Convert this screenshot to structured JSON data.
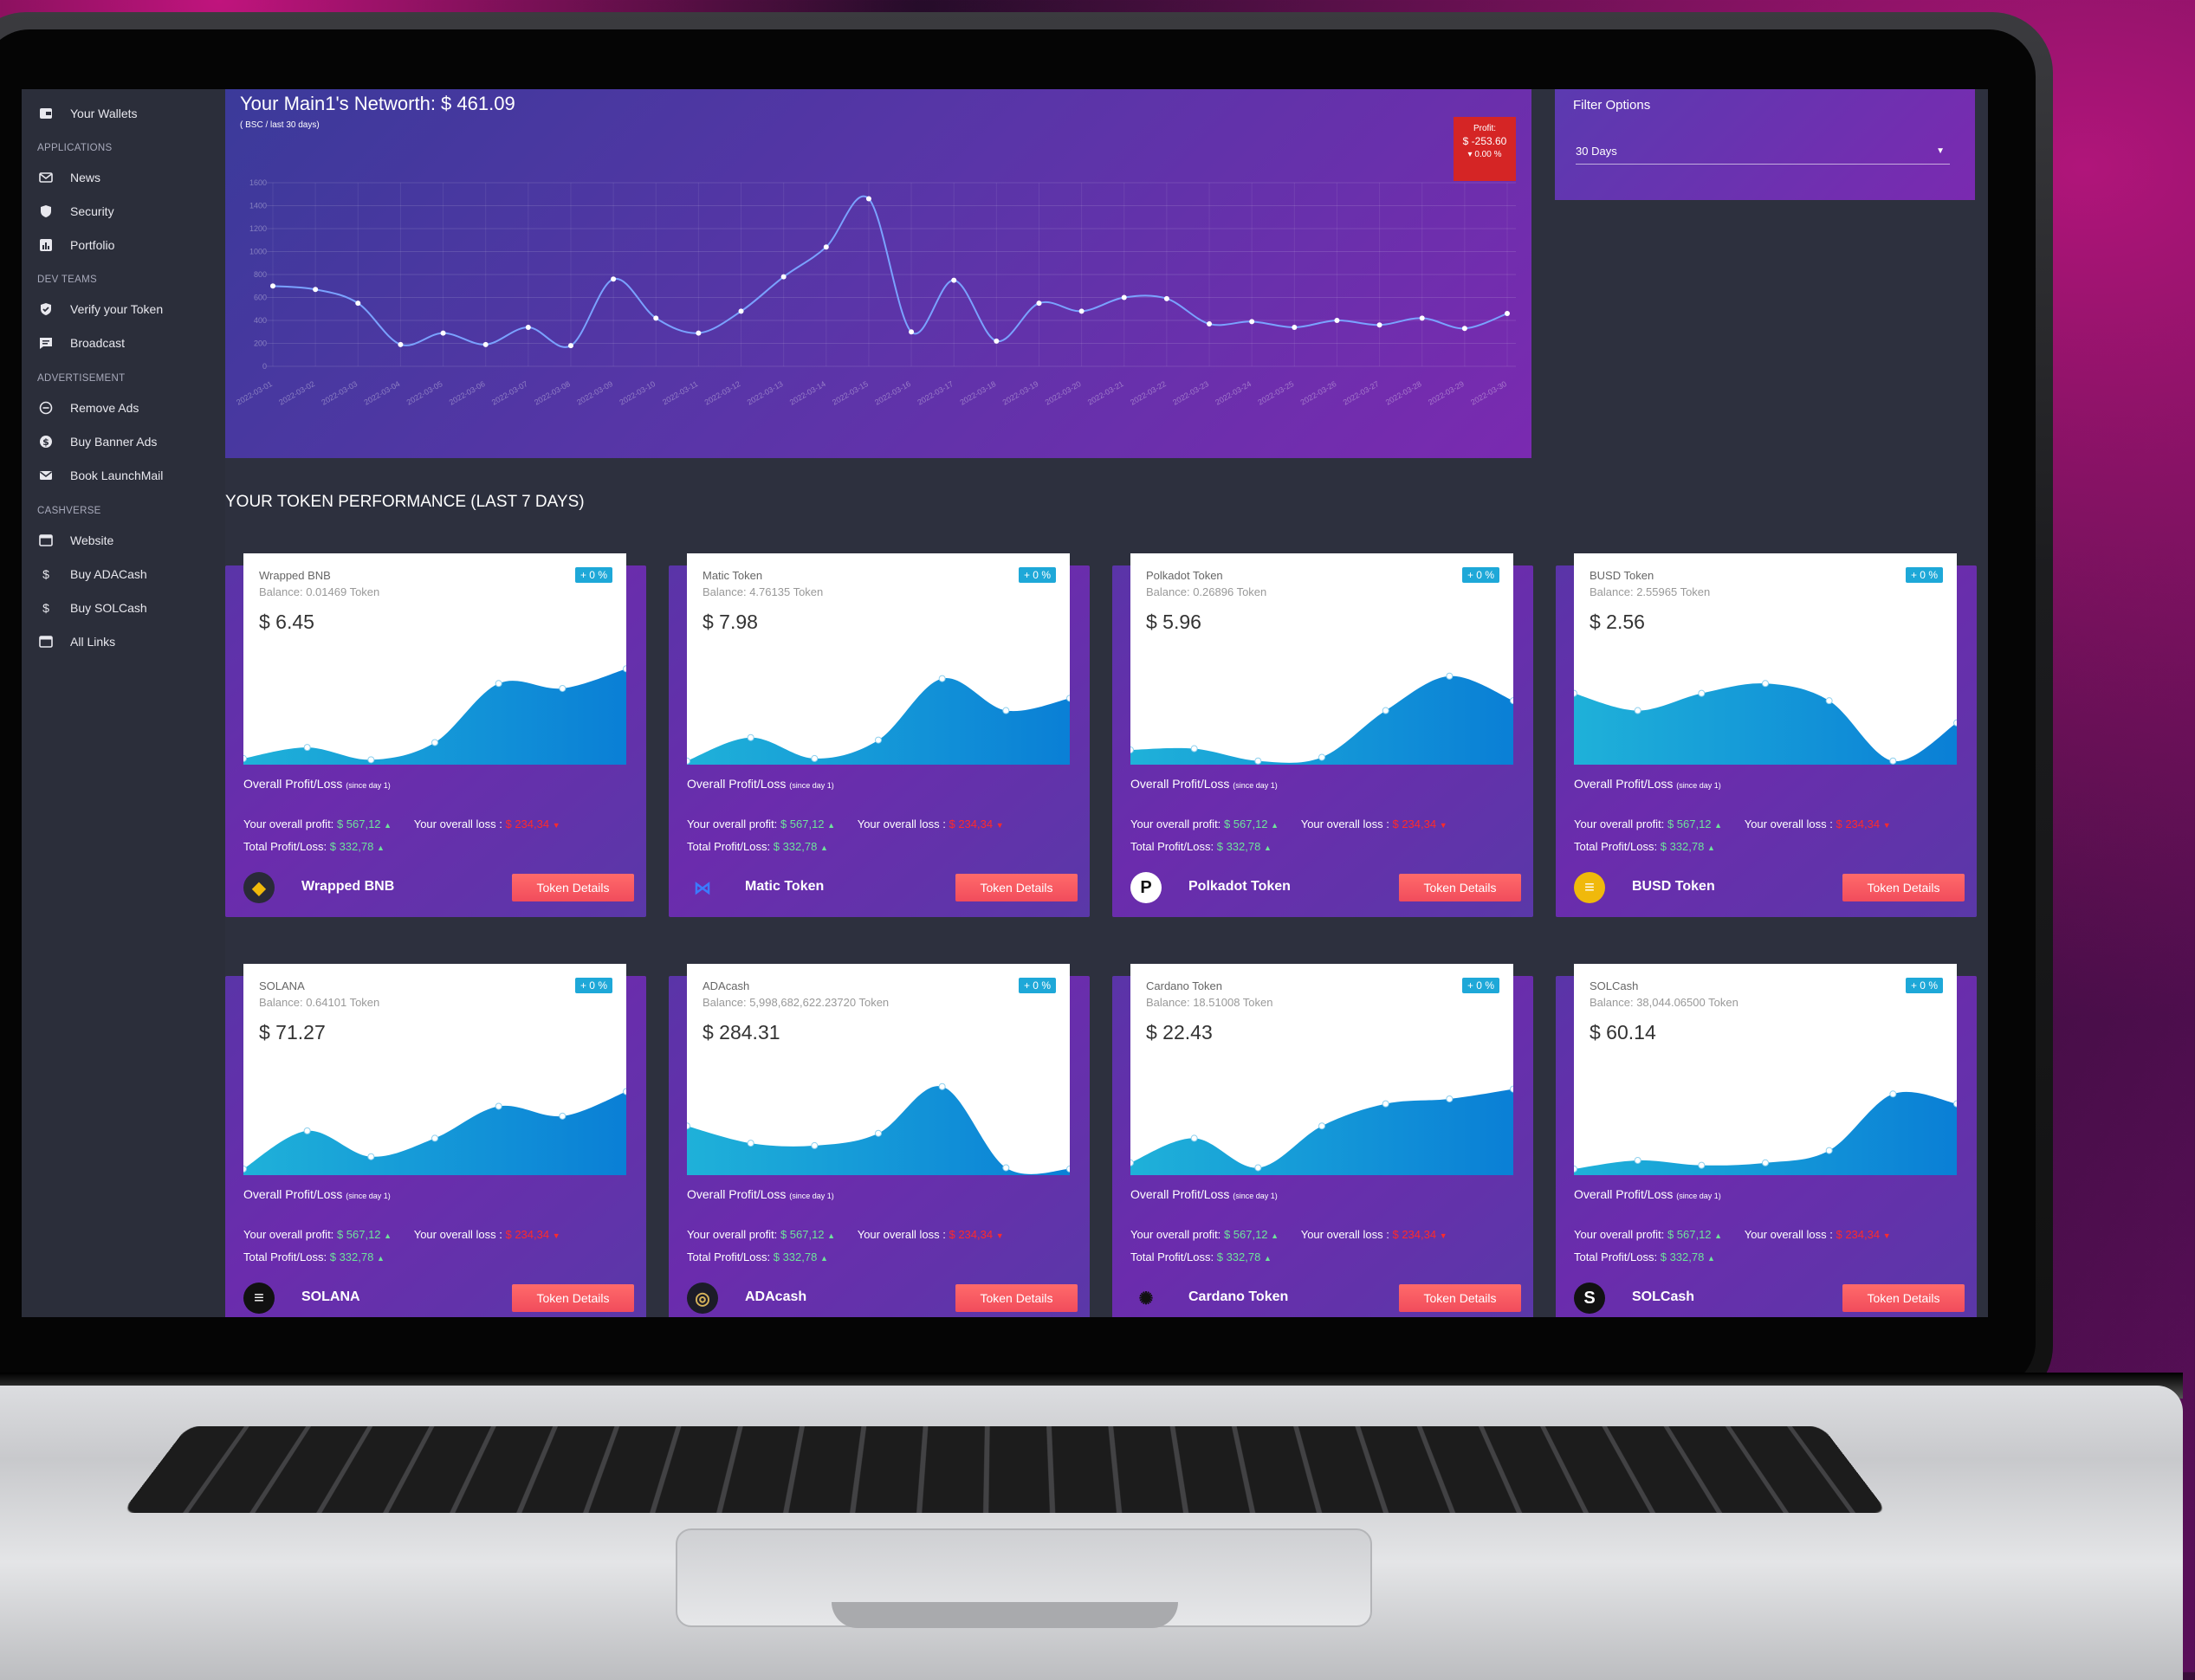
{
  "sidebar": {
    "wallets": "Your Wallets",
    "sections": [
      {
        "title": "APPLICATIONS",
        "items": [
          {
            "label": "News",
            "icon": "mail-icon"
          },
          {
            "label": "Security",
            "icon": "shield-icon"
          },
          {
            "label": "Portfolio",
            "icon": "chart-icon"
          }
        ]
      },
      {
        "title": "DEV TEAMS",
        "items": [
          {
            "label": "Verify your Token",
            "icon": "check-shield-icon"
          },
          {
            "label": "Broadcast",
            "icon": "message-icon"
          }
        ]
      },
      {
        "title": "ADVERTISEMENT",
        "items": [
          {
            "label": "Remove Ads",
            "icon": "minus-circle-icon"
          },
          {
            "label": "Buy Banner Ads",
            "icon": "dollar-circle-icon"
          },
          {
            "label": "Book LaunchMail",
            "icon": "mail-icon"
          }
        ]
      },
      {
        "title": "CASHVERSE",
        "items": [
          {
            "label": "Website",
            "icon": "browser-icon"
          },
          {
            "label": "Buy ADACash",
            "icon": "dollar-icon"
          },
          {
            "label": "Buy SOLCash",
            "icon": "dollar-icon"
          },
          {
            "label": "All Links",
            "icon": "browser-icon"
          }
        ]
      }
    ]
  },
  "networth": {
    "title": "Your Main1's Networth: $ 461.09",
    "subtitle": "( BSC / last 30 days)",
    "profit_label": "Profit:",
    "profit_value": "$ -253.60",
    "profit_pct": "0.00 %"
  },
  "filter": {
    "title": "Filter Options",
    "selected": "30 Days"
  },
  "section_title": "YOUR TOKEN PERFORMANCE (LAST 7 DAYS)",
  "card_text": {
    "overall": "Overall Profit/Loss",
    "since": "(since day 1)",
    "profit_label": "Your overall profit:",
    "profit_value": "$ 567,12",
    "loss_label": "Your overall loss :",
    "loss_value": "$ 234,34",
    "total_label": "Total Profit/Loss:",
    "total_value": "$ 332,78",
    "button": "Token Details"
  },
  "cards": [
    {
      "name": "Wrapped BNB",
      "balance": "Balance: 0.01469 Token",
      "price": "$ 6.45",
      "badge": "+ 0 %",
      "title": "Wrapped BNB",
      "logo": "bnb-logo-icon",
      "spark": [
        5,
        14,
        4,
        18,
        66,
        62,
        78
      ]
    },
    {
      "name": "Matic Token",
      "balance": "Balance: 4.76135 Token",
      "price": "$ 7.98",
      "badge": "+ 0 %",
      "title": "Matic Token",
      "logo": "matic-logo-icon",
      "spark": [
        3,
        22,
        5,
        20,
        70,
        44,
        54
      ]
    },
    {
      "name": "Polkadot Token",
      "balance": "Balance: 0.26896 Token",
      "price": "$ 5.96",
      "badge": "+ 0 %",
      "title": "Polkadot Token",
      "logo": "polkadot-logo-icon",
      "spark": [
        12,
        13,
        3,
        6,
        44,
        72,
        52
      ]
    },
    {
      "name": "BUSD Token",
      "balance": "Balance: 2.55965 Token",
      "price": "$ 2.56",
      "badge": "+ 0 %",
      "title": "BUSD Token",
      "logo": "busd-logo-icon",
      "spark": [
        58,
        44,
        58,
        66,
        52,
        3,
        34
      ]
    },
    {
      "name": "SOLANA",
      "balance": "Balance: 0.64101 Token",
      "price": "$ 71.27",
      "badge": "+ 0 %",
      "title": "SOLANA",
      "logo": "solana-logo-icon",
      "spark": [
        5,
        36,
        15,
        30,
        56,
        48,
        68
      ]
    },
    {
      "name": "ADAcash",
      "balance": "Balance: 5,998,682,622.23720 Token",
      "price": "$ 284.31",
      "badge": "+ 0 %",
      "title": "ADAcash",
      "logo": "adacash-logo-icon",
      "spark": [
        40,
        26,
        24,
        34,
        72,
        6,
        5
      ]
    },
    {
      "name": "Cardano Token",
      "balance": "Balance: 18.51008 Token",
      "price": "$ 22.43",
      "badge": "+ 0 %",
      "title": "Cardano Token",
      "logo": "cardano-logo-icon",
      "spark": [
        10,
        30,
        6,
        40,
        58,
        62,
        70
      ]
    },
    {
      "name": "SOLCash",
      "balance": "Balance: 38,044.06500 Token",
      "price": "$ 60.14",
      "badge": "+ 0 %",
      "title": "SOLCash",
      "logo": "solcash-logo-icon",
      "spark": [
        5,
        12,
        8,
        10,
        20,
        66,
        58
      ]
    }
  ],
  "chart_data": {
    "type": "line",
    "title": "",
    "y_ticks": [
      "0",
      "200",
      "400",
      "600",
      "800",
      "1000",
      "1200",
      "1400",
      "1600"
    ],
    "ylim": [
      0,
      1600
    ],
    "grid": true,
    "x": [
      "2022-03-01",
      "2022-03-02",
      "2022-03-03",
      "2022-03-04",
      "2022-03-05",
      "2022-03-06",
      "2022-03-07",
      "2022-03-08",
      "2022-03-09",
      "2022-03-10",
      "2022-03-11",
      "2022-03-12",
      "2022-03-13",
      "2022-03-14",
      "2022-03-15",
      "2022-03-16",
      "2022-03-17",
      "2022-03-18",
      "2022-03-19",
      "2022-03-20",
      "2022-03-21",
      "2022-03-22",
      "2022-03-23",
      "2022-03-24",
      "2022-03-25",
      "2022-03-26",
      "2022-03-27",
      "2022-03-28",
      "2022-03-29",
      "2022-03-30"
    ],
    "values": [
      700,
      670,
      550,
      190,
      290,
      190,
      340,
      180,
      760,
      420,
      290,
      480,
      780,
      1040,
      1460,
      300,
      750,
      220,
      550,
      480,
      600,
      590,
      370,
      390,
      340,
      400,
      360,
      420,
      330,
      460
    ]
  },
  "colors": {
    "accent": "#1ea8d8",
    "profit_box": "#d52525",
    "button": "#f14c5c",
    "green": "#6fe39b",
    "red": "#ff2a2a"
  }
}
